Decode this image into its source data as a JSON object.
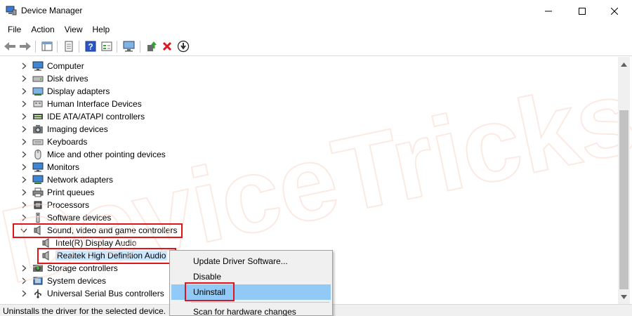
{
  "window": {
    "title": "Device Manager",
    "minimize_glyph": "—",
    "maximize_glyph": "☐",
    "close_glyph": "✕"
  },
  "menu": {
    "items": [
      "File",
      "Action",
      "View",
      "Help"
    ]
  },
  "toolbar": {
    "icons": [
      "back-arrow-icon",
      "forward-arrow-icon",
      "tree-view-icon",
      "properties-sheet-icon",
      "help-icon",
      "resource-view-icon",
      "monitor-scan-icon",
      "update-driver-icon",
      "uninstall-x-icon",
      "download-circle-icon"
    ]
  },
  "tree": {
    "categories": [
      {
        "label": "Computer",
        "icon": "computer-icon",
        "expanded": false
      },
      {
        "label": "Disk drives",
        "icon": "disk-drive-icon",
        "expanded": false
      },
      {
        "label": "Display adapters",
        "icon": "display-adapter-icon",
        "expanded": false
      },
      {
        "label": "Human Interface Devices",
        "icon": "hid-icon",
        "expanded": false
      },
      {
        "label": "IDE ATA/ATAPI controllers",
        "icon": "ide-controller-icon",
        "expanded": false
      },
      {
        "label": "Imaging devices",
        "icon": "camera-icon",
        "expanded": false
      },
      {
        "label": "Keyboards",
        "icon": "keyboard-icon",
        "expanded": false
      },
      {
        "label": "Mice and other pointing devices",
        "icon": "mouse-icon",
        "expanded": false
      },
      {
        "label": "Monitors",
        "icon": "monitor-icon",
        "expanded": false
      },
      {
        "label": "Network adapters",
        "icon": "network-adapter-icon",
        "expanded": false
      },
      {
        "label": "Print queues",
        "icon": "printer-icon",
        "expanded": false
      },
      {
        "label": "Processors",
        "icon": "processor-icon",
        "expanded": false
      },
      {
        "label": "Software devices",
        "icon": "software-device-icon",
        "expanded": false
      },
      {
        "label": "Sound, video and game controllers",
        "icon": "speaker-icon",
        "expanded": true
      },
      {
        "label": "Intel(R) Display Audio",
        "icon": "speaker-icon",
        "child": true
      },
      {
        "label": "Realtek High Definition Audio",
        "icon": "speaker-icon",
        "child": true,
        "selected": true
      },
      {
        "label": "Storage controllers",
        "icon": "storage-controller-icon",
        "expanded": false
      },
      {
        "label": "System devices",
        "icon": "system-device-icon",
        "expanded": false
      },
      {
        "label": "Universal Serial Bus controllers",
        "icon": "usb-icon",
        "expanded": false
      }
    ]
  },
  "context_menu": {
    "items": [
      {
        "label": "Update Driver Software..."
      },
      {
        "label": "Disable"
      },
      {
        "label": "Uninstall",
        "active": true
      },
      {
        "label": "Scan for hardware changes"
      }
    ]
  },
  "status": {
    "text": "Uninstalls the driver for the selected device."
  },
  "watermark": {
    "text": "DeviceTricks"
  },
  "colors": {
    "highlight_red": "#e0141d",
    "selection_blue": "#cce8ff",
    "menu_hover_blue": "#91c9f7",
    "watermark": "#f6d9cc"
  }
}
